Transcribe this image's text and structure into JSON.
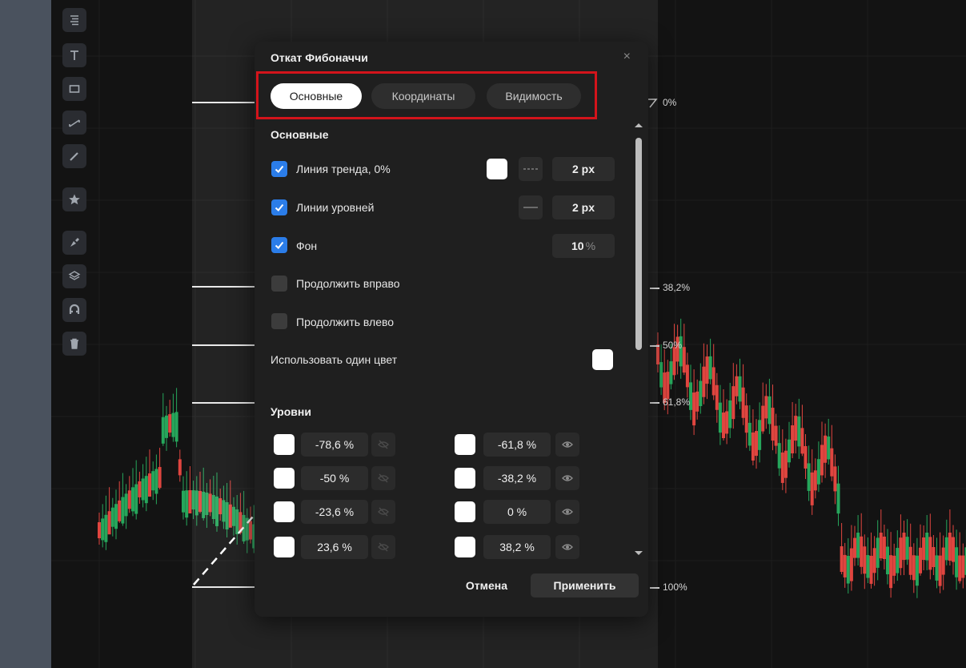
{
  "dialog": {
    "title": "Откат Фибоначчи",
    "close_glyph": "×",
    "tabs": [
      {
        "label": "Основные",
        "active": true
      },
      {
        "label": "Координаты",
        "active": false
      },
      {
        "label": "Видимость",
        "active": false
      }
    ],
    "main_section_title": "Основные",
    "rows": {
      "trend_line": {
        "label": "Линия тренда, 0%",
        "checked": true,
        "width_value": "2 px"
      },
      "level_lines": {
        "label": "Линии уровней",
        "checked": true,
        "width_value": "2 px"
      },
      "background": {
        "label": "Фон",
        "checked": true,
        "value": "10",
        "unit": "%"
      },
      "extend_right": {
        "label": "Продолжить вправо",
        "checked": false
      },
      "extend_left": {
        "label": "Продолжить влево",
        "checked": false
      },
      "single_color": {
        "label": "Использовать один цвет"
      }
    },
    "levels_section_title": "Уровни",
    "levels_left": [
      {
        "value": "-78,6 %",
        "visible": false
      },
      {
        "value": "-50 %",
        "visible": false
      },
      {
        "value": "-23,6 %",
        "visible": false
      },
      {
        "value": "23,6 %",
        "visible": false
      }
    ],
    "levels_right": [
      {
        "value": "-61,8 %",
        "visible": true
      },
      {
        "value": "-38,2 %",
        "visible": true
      },
      {
        "value": "0 %",
        "visible": true
      },
      {
        "value": "38,2 %",
        "visible": true
      }
    ],
    "cancel_label": "Отмена",
    "apply_label": "Применить"
  },
  "chart": {
    "fib_labels": {
      "l0": "0%",
      "l382": "38,2%",
      "l50": "50%",
      "l618": "61,8%",
      "l100": "100%"
    },
    "colors": {
      "up": "#26a65b",
      "down": "#e0453f",
      "accent": "#2b7de9",
      "highlight": "#d3141b"
    }
  },
  "toolbar": {
    "icons": [
      "menu-lines-icon",
      "text-icon",
      "rectangle-icon",
      "trendline-icon",
      "pencil-icon",
      "star-icon",
      "brush-icon",
      "layers-icon",
      "magnet-icon",
      "trash-icon"
    ]
  }
}
